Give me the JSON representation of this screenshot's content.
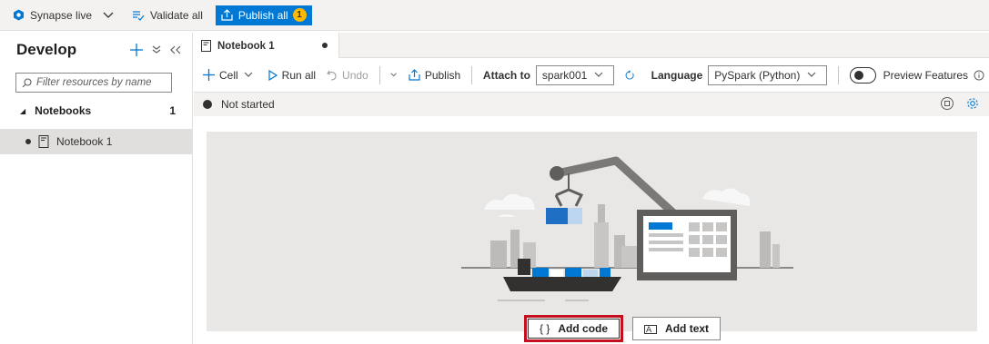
{
  "topbar": {
    "workspace_label": "Synapse live",
    "validate_label": "Validate all",
    "publish_label": "Publish all",
    "publish_count": "1"
  },
  "sidebar": {
    "title": "Develop",
    "filter_placeholder": "Filter resources by name",
    "section_label": "Notebooks",
    "section_count": "1",
    "items": [
      {
        "label": "Notebook 1"
      }
    ]
  },
  "tab": {
    "label": "Notebook 1"
  },
  "toolbar": {
    "cell_label": "Cell",
    "run_all_label": "Run all",
    "undo_label": "Undo",
    "publish_label": "Publish",
    "attach_label": "Attach to",
    "attach_value": "spark001",
    "language_label": "Language",
    "language_value": "PySpark (Python)",
    "preview_label": "Preview Features"
  },
  "status": {
    "text": "Not started"
  },
  "cell_actions": {
    "add_code_label": "Add code",
    "add_text_label": "Add text"
  },
  "colors": {
    "accent": "#0078d4",
    "highlight": "#c50f1f",
    "badge": "#ffb900"
  }
}
